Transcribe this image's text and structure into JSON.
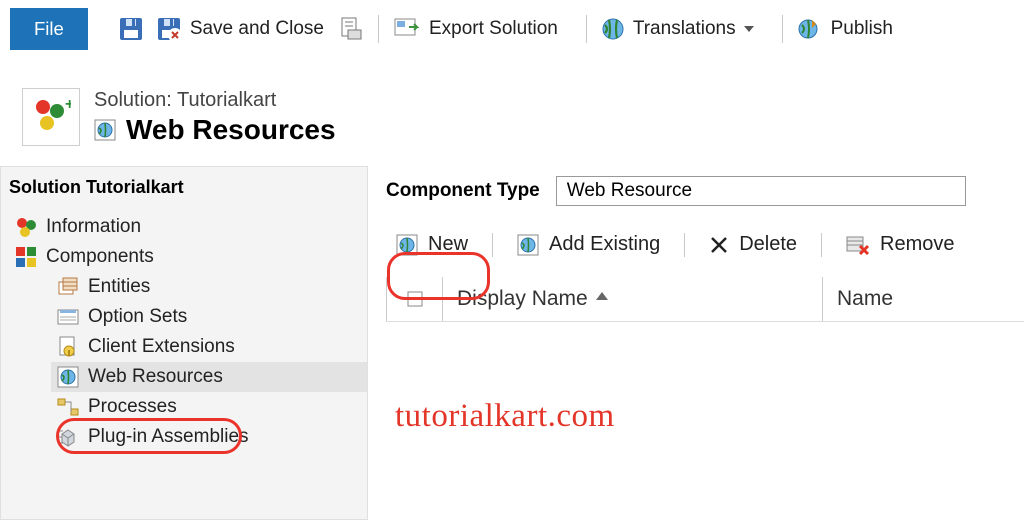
{
  "toolbar": {
    "file": "File",
    "save_close": "Save and Close",
    "export": "Export Solution",
    "translations": "Translations",
    "publish": "Publish"
  },
  "header": {
    "sub": "Solution: Tutorialkart",
    "title": "Web Resources"
  },
  "sidebar": {
    "title": "Solution Tutorialkart",
    "items": [
      {
        "label": "Information"
      },
      {
        "label": "Components"
      },
      {
        "label": "Entities"
      },
      {
        "label": "Option Sets"
      },
      {
        "label": "Client Extensions"
      },
      {
        "label": "Web Resources"
      },
      {
        "label": "Processes"
      },
      {
        "label": "Plug-in Assemblies"
      }
    ]
  },
  "main": {
    "comp_type_label": "Component Type",
    "comp_type_value": "Web Resource",
    "actions": {
      "new": "New",
      "add_existing": "Add Existing",
      "delete": "Delete",
      "remove": "Remove"
    },
    "columns": {
      "display_name": "Display Name",
      "name": "Name"
    }
  },
  "watermark": "tutorialkart.com"
}
